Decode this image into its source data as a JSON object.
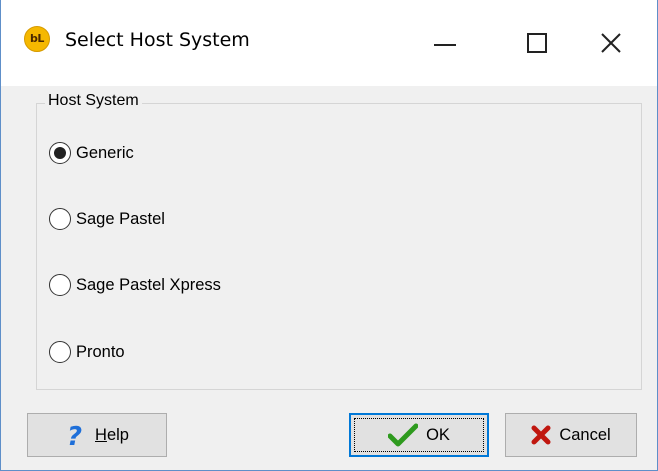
{
  "window": {
    "title": "Select Host System",
    "app_icon_text": "bL",
    "app_icon_color": "#f5b800"
  },
  "groupbox": {
    "legend": "Host System",
    "options": [
      {
        "label": "Generic",
        "selected": true
      },
      {
        "label": "Sage Pastel",
        "selected": false
      },
      {
        "label": "Sage Pastel Xpress",
        "selected": false
      },
      {
        "label": "Pronto",
        "selected": false
      }
    ]
  },
  "buttons": {
    "help_label": "Help",
    "ok_label": "OK",
    "cancel_label": "Cancel"
  },
  "icons": {
    "app": "app-logo-icon",
    "minimize": "minimize-icon",
    "maximize": "maximize-icon",
    "close": "close-icon",
    "help": "question-mark-icon",
    "ok": "checkmark-icon",
    "cancel": "x-mark-icon"
  },
  "colors": {
    "accent_focus": "#0078d7",
    "help_icon": "#1e6fd9",
    "ok_icon": "#2e9a1e",
    "cancel_icon": "#c0170f"
  }
}
